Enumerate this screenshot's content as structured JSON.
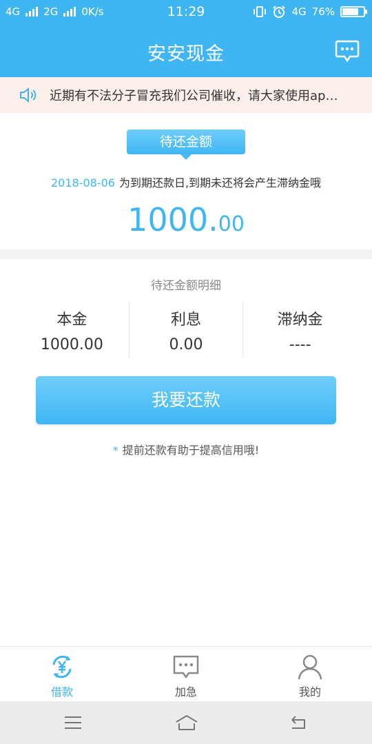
{
  "status_bar": {
    "network1": "4G",
    "network2": "2G",
    "speed": "0K/s",
    "time": "11:29",
    "network3": "4G",
    "battery": "76%",
    "battery_level": 0.76
  },
  "header": {
    "title": "安安现金"
  },
  "notice": {
    "text": "近期有不法分子冒充我们公司催收，请大家使用ap…"
  },
  "due": {
    "tag": "待还金额",
    "date": "2018-08-06",
    "message": "为到期还款日,到期未还将会产生滞纳金哦",
    "amount_int": "1000.",
    "amount_dec": "00"
  },
  "detail": {
    "title": "待还金额明细",
    "columns": [
      {
        "label": "本金",
        "value": "1000.00"
      },
      {
        "label": "利息",
        "value": "0.00"
      },
      {
        "label": "滞纳金",
        "value": "----"
      }
    ]
  },
  "repay_button": "我要还款",
  "tip": {
    "star": "*",
    "text": "提前还款有助于提高信用哦!"
  },
  "tabs": [
    {
      "label": "借款",
      "icon": "loan-yen-icon",
      "active": true
    },
    {
      "label": "加急",
      "icon": "chat-bubble-icon",
      "active": false
    },
    {
      "label": "我的",
      "icon": "person-icon",
      "active": false
    }
  ],
  "colors": {
    "primary": "#3fb6f2",
    "notice_bg": "#fdf0ea",
    "inactive": "#888888"
  }
}
